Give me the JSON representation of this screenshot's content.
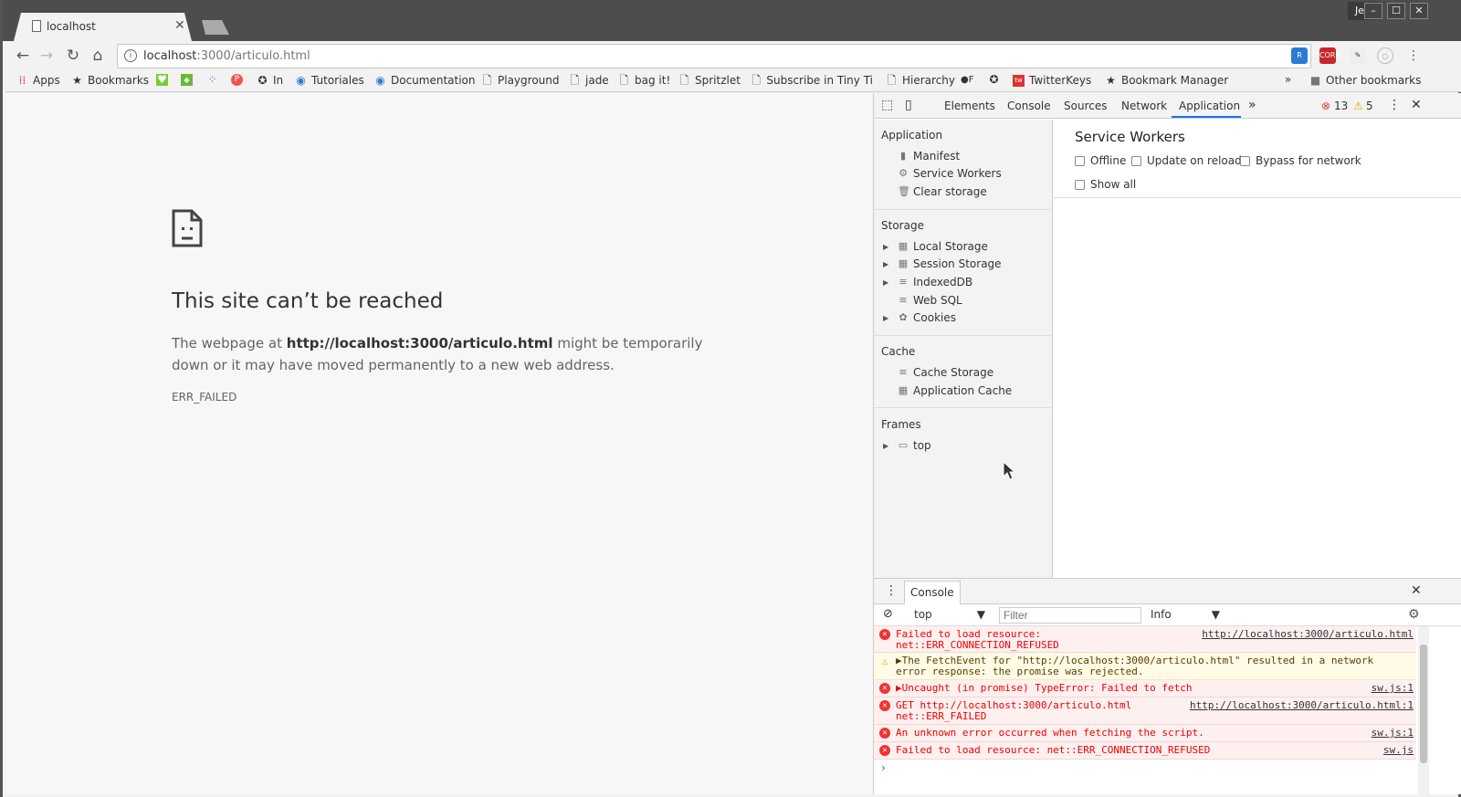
{
  "browser": {
    "tab_title": "localhost",
    "user": "Jess",
    "url_host": "localhost",
    "url_path": ":3000/articulo.html",
    "bookmarks": [
      {
        "label": "Apps",
        "icon": "apps-grid-icon"
      },
      {
        "label": "Bookmarks",
        "icon": "star-icon"
      },
      {
        "label": "In",
        "icon": "circle-icon"
      },
      {
        "label": "Tutoriales",
        "icon": "globe-icon"
      },
      {
        "label": "Documentation",
        "icon": "globe-icon"
      },
      {
        "label": "Playground",
        "icon": "page-icon"
      },
      {
        "label": "jade",
        "icon": "page-icon"
      },
      {
        "label": "bag it!",
        "icon": "page-icon"
      },
      {
        "label": "Spritzlet",
        "icon": "page-icon"
      },
      {
        "label": "Subscribe in Tiny Ti",
        "icon": "page-icon"
      },
      {
        "label": "Hierarchy",
        "icon": "page-icon"
      },
      {
        "label": "TwitterKeys",
        "icon": "twitter-icon"
      },
      {
        "label": "Bookmark Manager",
        "icon": "star-icon"
      },
      {
        "label": "Other bookmarks",
        "icon": "folder-icon"
      }
    ]
  },
  "page": {
    "title": "This site can’t be reached",
    "body_pre": "The webpage at ",
    "body_url": "http://localhost:3000/articulo.html",
    "body_post": " might be temporarily down or it may have moved permanently to a new web address.",
    "error_code": "ERR_FAILED"
  },
  "devtools": {
    "tabs": [
      "Elements",
      "Console",
      "Sources",
      "Network",
      "Application"
    ],
    "active_tab": "Application",
    "error_count": "13",
    "warning_count": "5",
    "sidebar": {
      "application_heading": "Application",
      "application_items": [
        "Manifest",
        "Service Workers",
        "Clear storage"
      ],
      "storage_heading": "Storage",
      "storage_items": [
        "Local Storage",
        "Session Storage",
        "IndexedDB",
        "Web SQL",
        "Cookies"
      ],
      "cache_heading": "Cache",
      "cache_items": [
        "Cache Storage",
        "Application Cache"
      ],
      "frames_heading": "Frames",
      "frames_items": [
        "top"
      ]
    },
    "service_workers": {
      "title": "Service Workers",
      "offline": "Offline",
      "update_on_reload": "Update on reload",
      "bypass": "Bypass for network",
      "show_all": "Show all"
    },
    "console": {
      "tab": "Console",
      "context": "top",
      "filter_placeholder": "Filter",
      "level": "Info",
      "messages": [
        {
          "type": "error",
          "text": "Failed to load resource:\nnet::ERR_CONNECTION_REFUSED",
          "source": "http://localhost:3000/articulo.html"
        },
        {
          "type": "warning",
          "text": "▶The FetchEvent for \"http://localhost:3000/articulo.html\" resulted in a network\nerror response: the promise was rejected.",
          "source": ""
        },
        {
          "type": "error",
          "text": "▶Uncaught (in promise) TypeError: Failed to fetch",
          "source": "sw.js:1"
        },
        {
          "type": "error",
          "text": "GET http://localhost:3000/articulo.html\nnet::ERR_FAILED",
          "source": "http://localhost:3000/articulo.html:1"
        },
        {
          "type": "error",
          "text": "An unknown error occurred when fetching the script.",
          "source": "sw.js:1"
        },
        {
          "type": "error",
          "text": "Failed to load resource: net::ERR_CONNECTION_REFUSED",
          "source": "sw.js"
        }
      ]
    }
  }
}
